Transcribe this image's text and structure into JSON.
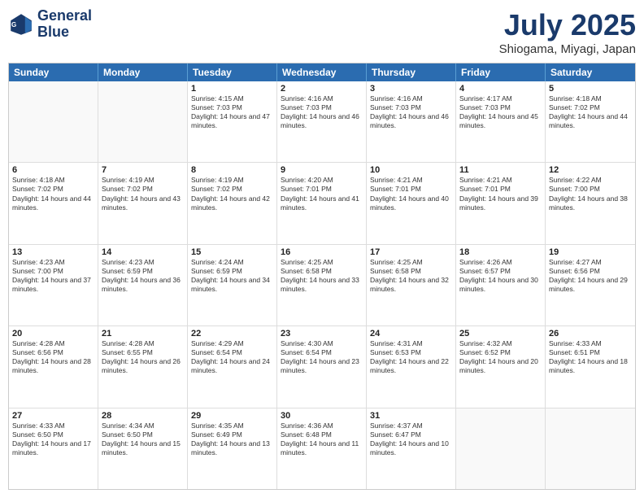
{
  "logo": {
    "line1": "General",
    "line2": "Blue"
  },
  "title": "July 2025",
  "subtitle": "Shiogama, Miyagi, Japan",
  "days": [
    "Sunday",
    "Monday",
    "Tuesday",
    "Wednesday",
    "Thursday",
    "Friday",
    "Saturday"
  ],
  "weeks": [
    [
      {
        "day": "",
        "info": ""
      },
      {
        "day": "",
        "info": ""
      },
      {
        "day": "1",
        "info": "Sunrise: 4:15 AM\nSunset: 7:03 PM\nDaylight: 14 hours and 47 minutes."
      },
      {
        "day": "2",
        "info": "Sunrise: 4:16 AM\nSunset: 7:03 PM\nDaylight: 14 hours and 46 minutes."
      },
      {
        "day": "3",
        "info": "Sunrise: 4:16 AM\nSunset: 7:03 PM\nDaylight: 14 hours and 46 minutes."
      },
      {
        "day": "4",
        "info": "Sunrise: 4:17 AM\nSunset: 7:03 PM\nDaylight: 14 hours and 45 minutes."
      },
      {
        "day": "5",
        "info": "Sunrise: 4:18 AM\nSunset: 7:02 PM\nDaylight: 14 hours and 44 minutes."
      }
    ],
    [
      {
        "day": "6",
        "info": "Sunrise: 4:18 AM\nSunset: 7:02 PM\nDaylight: 14 hours and 44 minutes."
      },
      {
        "day": "7",
        "info": "Sunrise: 4:19 AM\nSunset: 7:02 PM\nDaylight: 14 hours and 43 minutes."
      },
      {
        "day": "8",
        "info": "Sunrise: 4:19 AM\nSunset: 7:02 PM\nDaylight: 14 hours and 42 minutes."
      },
      {
        "day": "9",
        "info": "Sunrise: 4:20 AM\nSunset: 7:01 PM\nDaylight: 14 hours and 41 minutes."
      },
      {
        "day": "10",
        "info": "Sunrise: 4:21 AM\nSunset: 7:01 PM\nDaylight: 14 hours and 40 minutes."
      },
      {
        "day": "11",
        "info": "Sunrise: 4:21 AM\nSunset: 7:01 PM\nDaylight: 14 hours and 39 minutes."
      },
      {
        "day": "12",
        "info": "Sunrise: 4:22 AM\nSunset: 7:00 PM\nDaylight: 14 hours and 38 minutes."
      }
    ],
    [
      {
        "day": "13",
        "info": "Sunrise: 4:23 AM\nSunset: 7:00 PM\nDaylight: 14 hours and 37 minutes."
      },
      {
        "day": "14",
        "info": "Sunrise: 4:23 AM\nSunset: 6:59 PM\nDaylight: 14 hours and 36 minutes."
      },
      {
        "day": "15",
        "info": "Sunrise: 4:24 AM\nSunset: 6:59 PM\nDaylight: 14 hours and 34 minutes."
      },
      {
        "day": "16",
        "info": "Sunrise: 4:25 AM\nSunset: 6:58 PM\nDaylight: 14 hours and 33 minutes."
      },
      {
        "day": "17",
        "info": "Sunrise: 4:25 AM\nSunset: 6:58 PM\nDaylight: 14 hours and 32 minutes."
      },
      {
        "day": "18",
        "info": "Sunrise: 4:26 AM\nSunset: 6:57 PM\nDaylight: 14 hours and 30 minutes."
      },
      {
        "day": "19",
        "info": "Sunrise: 4:27 AM\nSunset: 6:56 PM\nDaylight: 14 hours and 29 minutes."
      }
    ],
    [
      {
        "day": "20",
        "info": "Sunrise: 4:28 AM\nSunset: 6:56 PM\nDaylight: 14 hours and 28 minutes."
      },
      {
        "day": "21",
        "info": "Sunrise: 4:28 AM\nSunset: 6:55 PM\nDaylight: 14 hours and 26 minutes."
      },
      {
        "day": "22",
        "info": "Sunrise: 4:29 AM\nSunset: 6:54 PM\nDaylight: 14 hours and 24 minutes."
      },
      {
        "day": "23",
        "info": "Sunrise: 4:30 AM\nSunset: 6:54 PM\nDaylight: 14 hours and 23 minutes."
      },
      {
        "day": "24",
        "info": "Sunrise: 4:31 AM\nSunset: 6:53 PM\nDaylight: 14 hours and 22 minutes."
      },
      {
        "day": "25",
        "info": "Sunrise: 4:32 AM\nSunset: 6:52 PM\nDaylight: 14 hours and 20 minutes."
      },
      {
        "day": "26",
        "info": "Sunrise: 4:33 AM\nSunset: 6:51 PM\nDaylight: 14 hours and 18 minutes."
      }
    ],
    [
      {
        "day": "27",
        "info": "Sunrise: 4:33 AM\nSunset: 6:50 PM\nDaylight: 14 hours and 17 minutes."
      },
      {
        "day": "28",
        "info": "Sunrise: 4:34 AM\nSunset: 6:50 PM\nDaylight: 14 hours and 15 minutes."
      },
      {
        "day": "29",
        "info": "Sunrise: 4:35 AM\nSunset: 6:49 PM\nDaylight: 14 hours and 13 minutes."
      },
      {
        "day": "30",
        "info": "Sunrise: 4:36 AM\nSunset: 6:48 PM\nDaylight: 14 hours and 11 minutes."
      },
      {
        "day": "31",
        "info": "Sunrise: 4:37 AM\nSunset: 6:47 PM\nDaylight: 14 hours and 10 minutes."
      },
      {
        "day": "",
        "info": ""
      },
      {
        "day": "",
        "info": ""
      }
    ]
  ]
}
